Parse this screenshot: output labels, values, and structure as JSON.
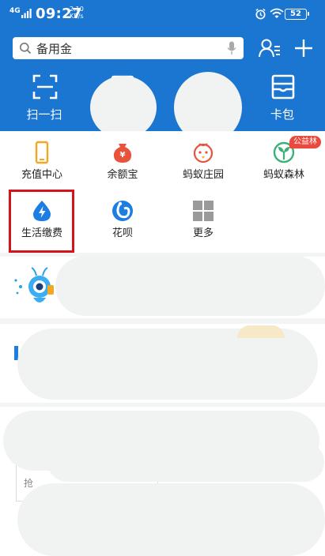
{
  "status_bar": {
    "network": "4G",
    "time": "09:27",
    "speed_value": "2.10",
    "speed_unit": "KB/s",
    "battery": "52"
  },
  "search": {
    "placeholder": "备用金"
  },
  "header_actions": [
    {
      "label": "扫一扫",
      "icon": "scan-icon"
    },
    {
      "label": "",
      "icon": "pay-icon"
    },
    {
      "label": "",
      "icon": "collect-icon"
    },
    {
      "label": "卡包",
      "icon": "card-wallet-icon"
    }
  ],
  "services": [
    {
      "label": "充值中心",
      "icon": "phone-recharge-icon",
      "color": "#f5a623"
    },
    {
      "label": "余额宝",
      "icon": "yuebao-icon",
      "color": "#e8533c"
    },
    {
      "label": "蚂蚁庄园",
      "icon": "ant-farm-icon",
      "color": "#e8533c"
    },
    {
      "label": "蚂蚁森林",
      "icon": "ant-forest-icon",
      "color": "#3caf7a"
    },
    {
      "label": "生活缴费",
      "icon": "utility-bill-icon",
      "color": "#1b7ee0"
    },
    {
      "label": "花呗",
      "icon": "huabei-icon",
      "color": "#1b7ee0"
    },
    {
      "label": "更多",
      "icon": "more-grid-icon",
      "color": "#8e8e8e"
    }
  ],
  "badge": {
    "label": "公益林"
  },
  "lower": {
    "partial_text": "抢"
  },
  "colors": {
    "brand_blue": "#1b76d1",
    "highlight_red": "#d4141c"
  }
}
